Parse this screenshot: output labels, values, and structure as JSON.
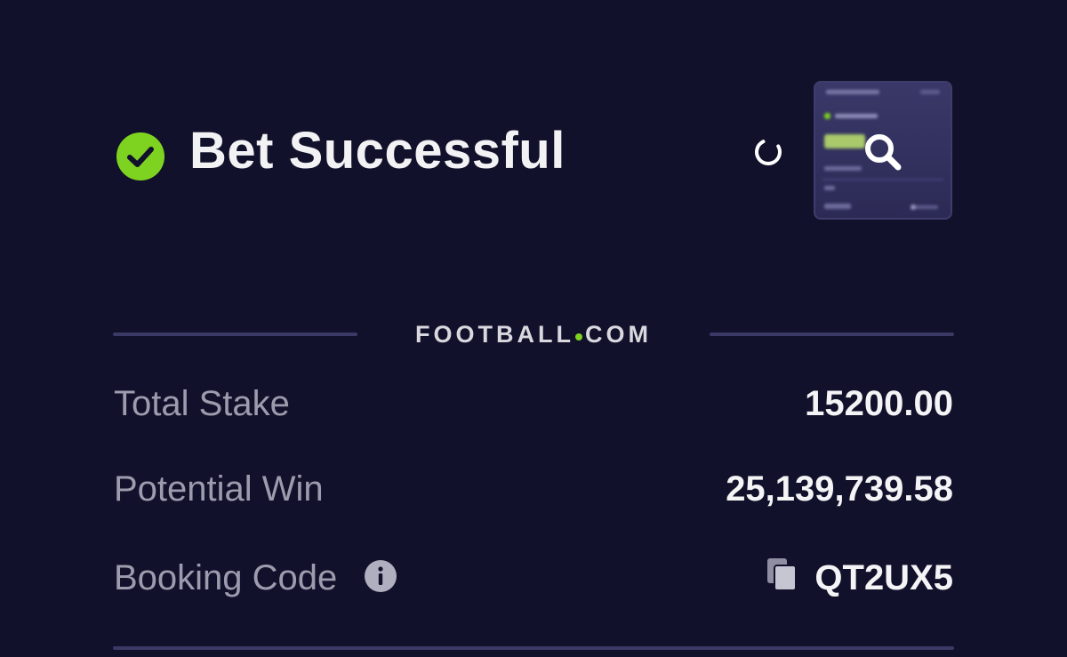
{
  "header": {
    "title": "Bet Successful",
    "status_icon": "check-circle-icon",
    "refresh_icon": "spinner-icon",
    "preview_icon": "magnifier-icon"
  },
  "brand": {
    "name_left": "FOOTBALL",
    "name_right": "COM"
  },
  "summary": {
    "total_stake": {
      "label": "Total Stake",
      "value": "15200.00"
    },
    "potential_win": {
      "label": "Potential Win",
      "value": "25,139,739.58"
    },
    "booking_code": {
      "label": "Booking Code",
      "value": "QT2UX5",
      "info_icon": "info-icon",
      "copy_icon": "copy-icon"
    }
  },
  "colors": {
    "background": "#12112b",
    "accent": "#7ed321",
    "divider": "#3b3a66",
    "label": "#9d9cae",
    "value": "#f4f4f6"
  }
}
